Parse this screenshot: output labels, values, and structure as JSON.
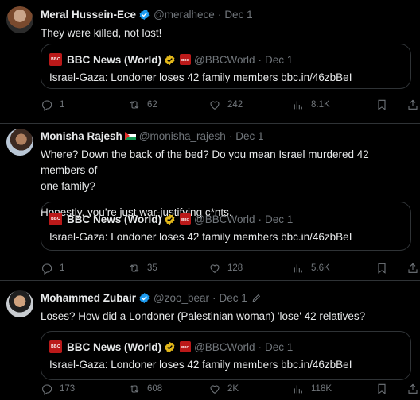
{
  "tweets": [
    {
      "name": "Meral Hussein-Ece",
      "handle": "@meralhece",
      "time": "Dec 1",
      "text": "They were killed, not lost!",
      "quote": {
        "name": "BBC News (World)",
        "handle": "@BBCWorld",
        "time": "Dec 1",
        "text": "Israel-Gaza: Londoner loses 42 family members bbc.in/46zbBeI"
      },
      "stats": {
        "replies": "1",
        "reposts": "62",
        "likes": "242",
        "views": "8.1K"
      }
    },
    {
      "name": "Monisha Rajesh",
      "handle": "@monisha_rajesh",
      "time": "Dec 1",
      "text_line1": "Where? Down the back of the bed? Do you mean Israel murdered 42 members of",
      "text_line2": "one family?",
      "text_line3": "Honestly, you’re just war-justifying c*nts.",
      "quote": {
        "name": "BBC News (World)",
        "handle": "@BBCWorld",
        "time": "Dec 1",
        "text": "Israel-Gaza: Londoner loses 42 family members bbc.in/46zbBeI"
      },
      "stats": {
        "replies": "1",
        "reposts": "35",
        "likes": "128",
        "views": "5.6K"
      }
    },
    {
      "name": "Mohammed Zubair",
      "handle": "@zoo_bear",
      "time": "Dec 1",
      "text": "Loses? How did a Londoner (Palestinian woman) 'lose' 42 relatives?",
      "quote": {
        "name": "BBC News (World)",
        "handle": "@BBCWorld",
        "time": "Dec 1",
        "text": "Israel-Gaza: Londoner loses 42 family members bbc.in/46zbBeI"
      },
      "stats": {
        "replies": "173",
        "reposts": "608",
        "likes": "2K",
        "views": "118K"
      }
    }
  ],
  "bbc_logo_text": "BBC",
  "icons": [
    "verified-badge-icon",
    "gold-badge-icon",
    "reply-icon",
    "repost-icon",
    "like-icon",
    "views-icon",
    "bookmark-icon",
    "share-icon",
    "edit-pencil-icon"
  ],
  "colors": {
    "background": "#000000",
    "border": "#2f3336",
    "muted": "#71767b",
    "verified": "#1d9bf0",
    "gold": "#e2b719",
    "bbc_red": "#bb1919"
  }
}
